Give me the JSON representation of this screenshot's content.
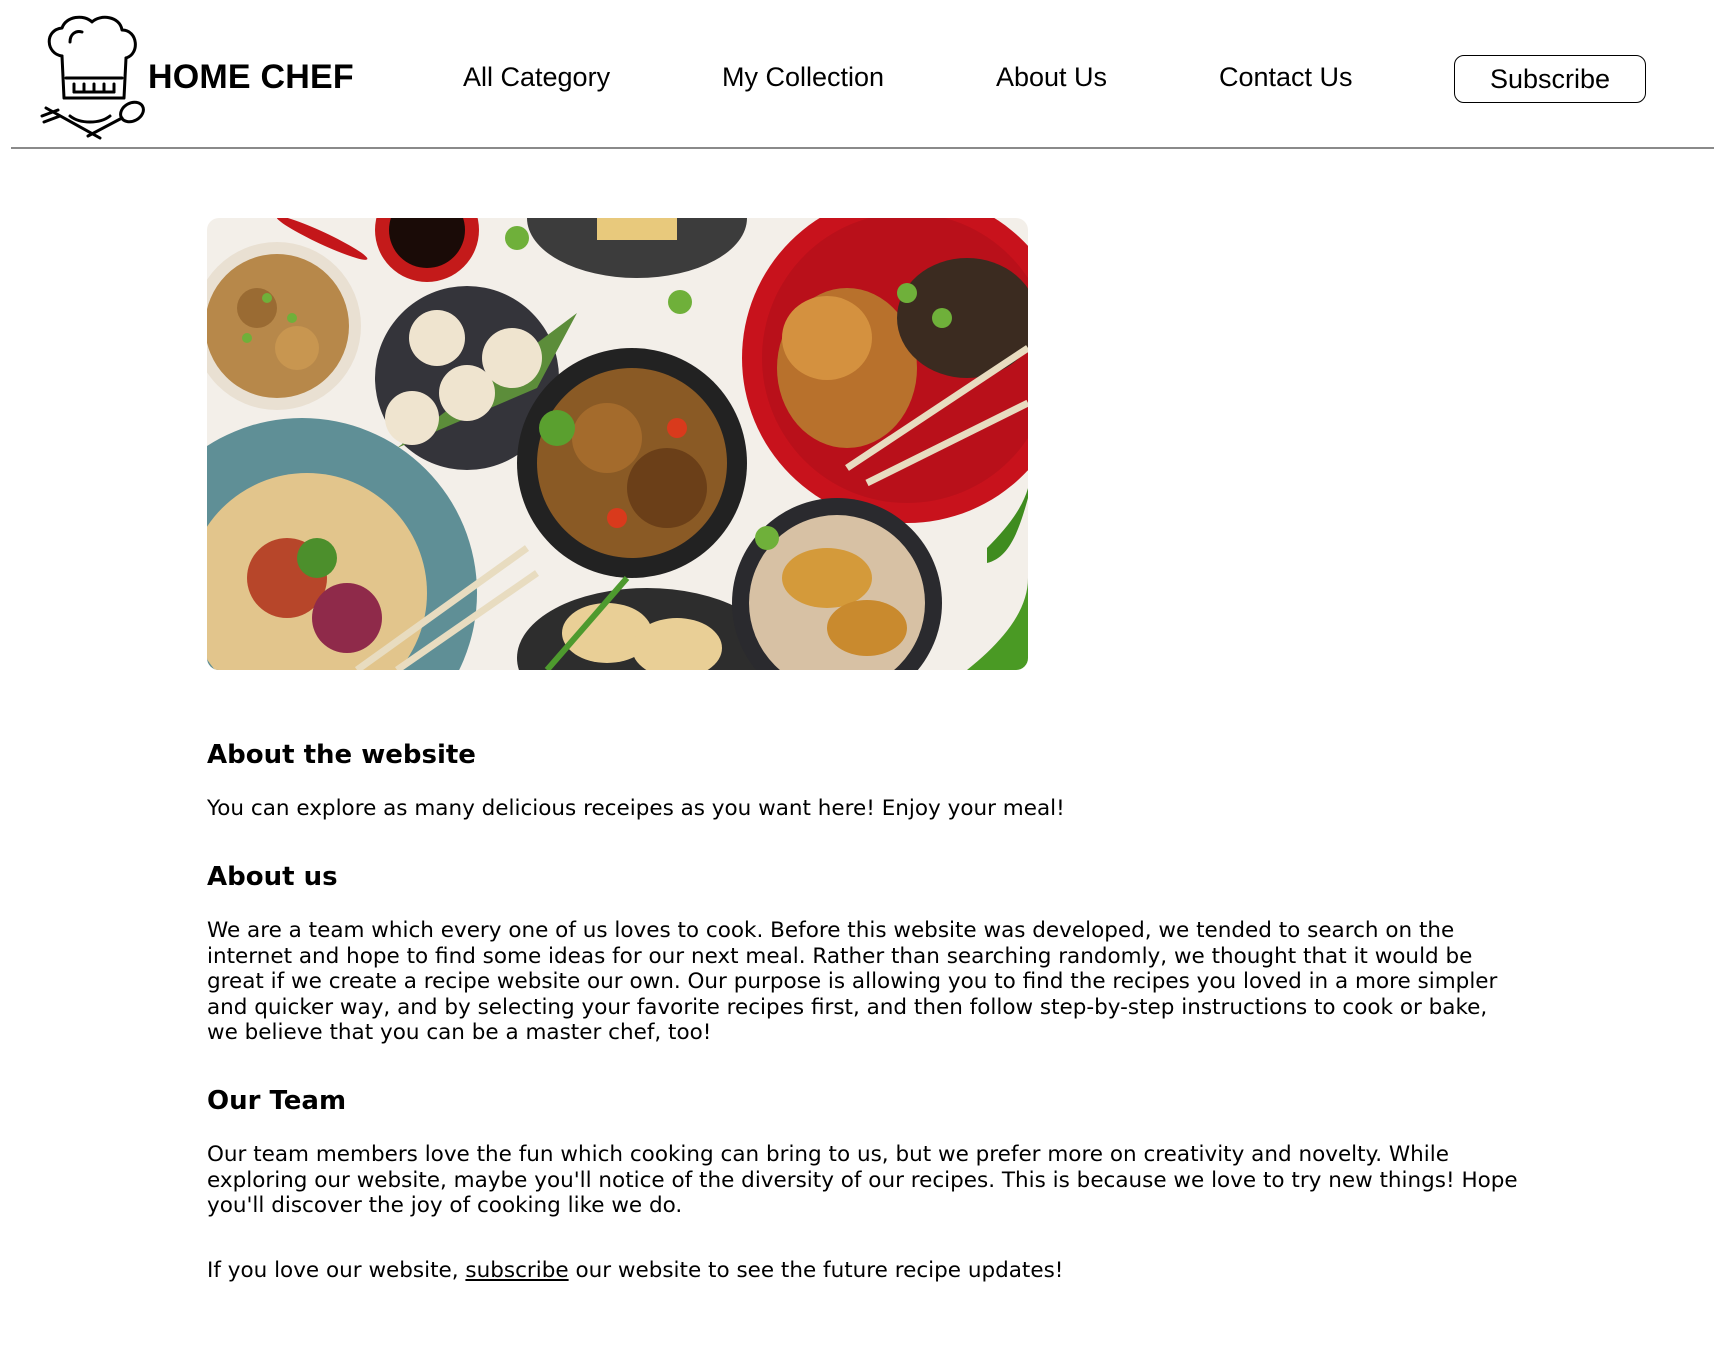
{
  "header": {
    "brand": "HOME CHEF",
    "logo_icon": "chef-hat-utensils-icon",
    "nav": [
      "All Category",
      "My Collection",
      "About Us",
      "Contact Us"
    ],
    "subscribe_label": "Subscribe"
  },
  "hero": {
    "image": "asian-food-dishes-photo"
  },
  "sections": {
    "about_website": {
      "title": "About the website",
      "body": "You can explore as many delicious receipes as you want here! Enjoy your meal!"
    },
    "about_us": {
      "title": "About us",
      "body": "We are a team which every one of us loves to cook. Before this website was developed, we tended to search on the internet and hope to find some ideas for our next meal. Rather than searching randomly, we thought that it would be great if we create a recipe website our own. Our purpose is allowing you to find the recipes you loved in a more simpler and quicker way, and by selecting your favorite recipes first, and then follow step-by-step instructions to cook or bake, we believe that you can be a master chef, too!"
    },
    "our_team": {
      "title": "Our Team",
      "body": "Our team members love the fun which cooking can bring to us, but we prefer more on creativity and novelty. While exploring our website, maybe you'll notice of the diversity of our recipes. This is because we love to try new things! Hope you'll discover the joy of cooking like we do."
    },
    "cta": {
      "prefix": "If you love our website, ",
      "link": "subscribe",
      "suffix": " our website to see the future recipe updates!"
    }
  },
  "colors": {
    "rule": "#8a8a8a",
    "text": "#000000"
  }
}
